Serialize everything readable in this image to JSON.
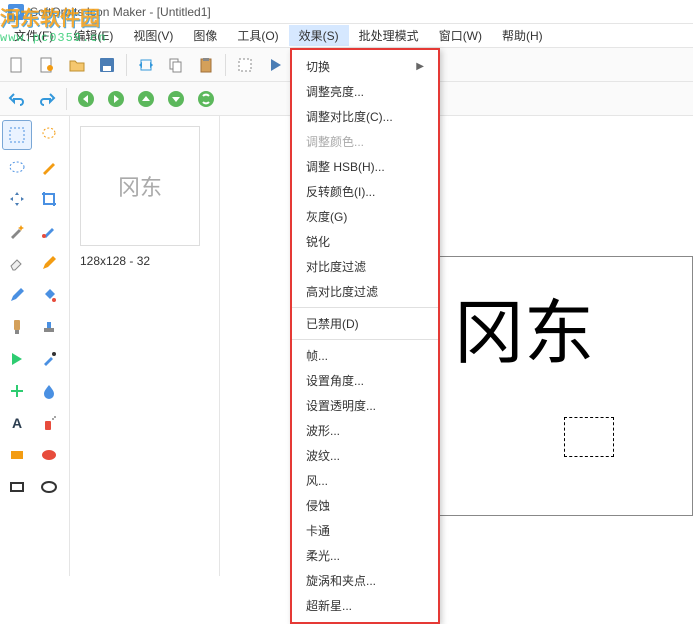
{
  "window": {
    "title": "SoftOrbits Icon Maker - [Untitled1]"
  },
  "watermark": {
    "line1": "河东软件园",
    "line2": "www.pc0359.cn"
  },
  "menubar": {
    "items": [
      {
        "label": "文件(F)"
      },
      {
        "label": "编辑(E)"
      },
      {
        "label": "视图(V)"
      },
      {
        "label": "图像"
      },
      {
        "label": "工具(O)"
      },
      {
        "label": "效果(S)",
        "open": true
      },
      {
        "label": "批处理模式"
      },
      {
        "label": "窗口(W)"
      },
      {
        "label": "帮助(H)"
      }
    ]
  },
  "effects_menu": [
    {
      "label": "切换",
      "submenu": true
    },
    {
      "label": "调整亮度..."
    },
    {
      "label": "调整对比度(C)..."
    },
    {
      "label": "调整颜色...",
      "disabled": true
    },
    {
      "label": "调整 HSB(H)..."
    },
    {
      "label": "反转颜色(I)..."
    },
    {
      "label": "灰度(G)"
    },
    {
      "label": "锐化"
    },
    {
      "label": "对比度过滤"
    },
    {
      "label": "高对比度过滤"
    },
    {
      "sep": true
    },
    {
      "label": "已禁用(D)"
    },
    {
      "sep": true
    },
    {
      "label": "帧..."
    },
    {
      "label": "设置角度..."
    },
    {
      "label": "设置透明度..."
    },
    {
      "label": "波形..."
    },
    {
      "label": "波纹..."
    },
    {
      "label": "风..."
    },
    {
      "label": "侵蚀"
    },
    {
      "label": "卡通"
    },
    {
      "label": "柔光..."
    },
    {
      "label": "旋涡和夹点..."
    },
    {
      "label": "超新星..."
    }
  ],
  "toolbar1": [
    "new-doc",
    "new-doc2",
    "open",
    "save",
    "sep",
    "transform",
    "copy",
    "paste",
    "sep",
    "cut",
    "play",
    "sep",
    "circle-gray",
    "circle-dark",
    "sep",
    "gear",
    "sep",
    "settings"
  ],
  "toolbar2": [
    "undo",
    "redo",
    "sep",
    "nav-left",
    "nav-right",
    "nav-up",
    "nav-down",
    "refresh",
    "sep",
    "nav-left2",
    "nav-right2",
    "nav-up2",
    "nav-down2",
    "refresh2"
  ],
  "toolbox": [
    "select-rect",
    "select-lasso",
    "select-ellipse",
    "select-wand",
    "move",
    "crop",
    "wand",
    "brush",
    "eraser",
    "pencil",
    "clone",
    "bucket",
    "line",
    "stamp",
    "shapes",
    "eyedropper",
    "plus",
    "blur",
    "text",
    "spray",
    "rect",
    "ellipse",
    "rect2",
    "ring"
  ],
  "thumbnail": {
    "text": "冈东",
    "size_label": "128x128 - 32"
  },
  "canvas": {
    "text": "冈东"
  }
}
